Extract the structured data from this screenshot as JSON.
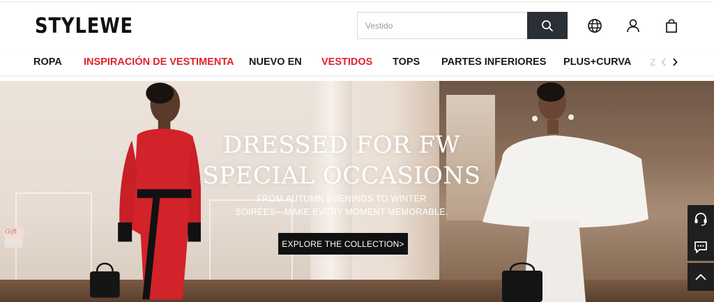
{
  "header": {
    "logo": "STYLEWE",
    "search": {
      "placeholder": "Vestido",
      "value": ""
    },
    "icons": [
      "search-icon",
      "globe-icon",
      "user-icon",
      "bag-icon"
    ]
  },
  "nav": {
    "items": [
      {
        "label": "ROPA",
        "highlight": false
      },
      {
        "label": "INSPIRACIÓN DE VESTIMENTA",
        "highlight": true
      },
      {
        "label": "NUEVO EN",
        "highlight": false
      },
      {
        "label": "VESTIDOS",
        "highlight": true
      },
      {
        "label": "TOPS",
        "highlight": false
      },
      {
        "label": "PARTES INFERIORES",
        "highlight": false
      },
      {
        "label": "PLUS+CURVA",
        "highlight": false
      }
    ],
    "overflow_hint": "Z"
  },
  "hero": {
    "title_line1": "DRESSED FOR FW",
    "title_line2": "SPECIAL OCCASIONS",
    "subtitle_line1": "FROM AUTUMN EVENINGS TO WINTER",
    "subtitle_line2": "SOIRÉES—MAKE EVERY MOMENT MEMORABLE.",
    "cta": "EXPLORE THE COLLECTION>"
  },
  "gift": {
    "label": "Gift"
  },
  "colors": {
    "accent_red": "#e0242b",
    "search_button": "#2b2f36",
    "side_buttons": "#1f1f1f"
  }
}
